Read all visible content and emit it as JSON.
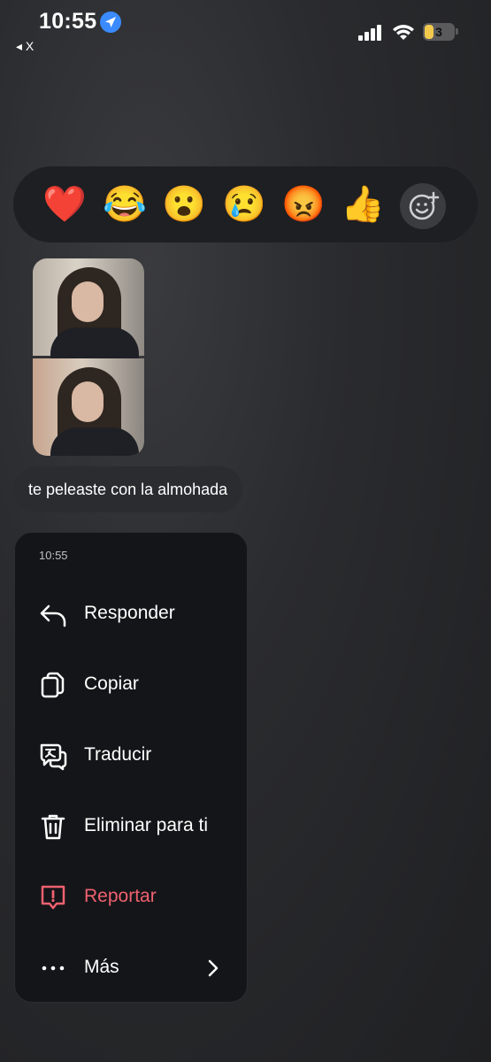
{
  "status_bar": {
    "time": "10:55",
    "back_label": "◂ X",
    "battery_level": "3"
  },
  "reactions": [
    "❤️",
    "😂",
    "😮",
    "😢",
    "😡",
    "👍"
  ],
  "message": {
    "text": "te peleaste con la almohada"
  },
  "menu": {
    "time": "10:55",
    "items": [
      {
        "label": "Responder",
        "icon": "reply-icon"
      },
      {
        "label": "Copiar",
        "icon": "copy-icon"
      },
      {
        "label": "Traducir",
        "icon": "translate-icon"
      },
      {
        "label": "Eliminar para ti",
        "icon": "trash-icon"
      },
      {
        "label": "Reportar",
        "icon": "report-icon",
        "color": "#ef6170"
      },
      {
        "label": "Más",
        "icon": "more-icon"
      }
    ]
  }
}
